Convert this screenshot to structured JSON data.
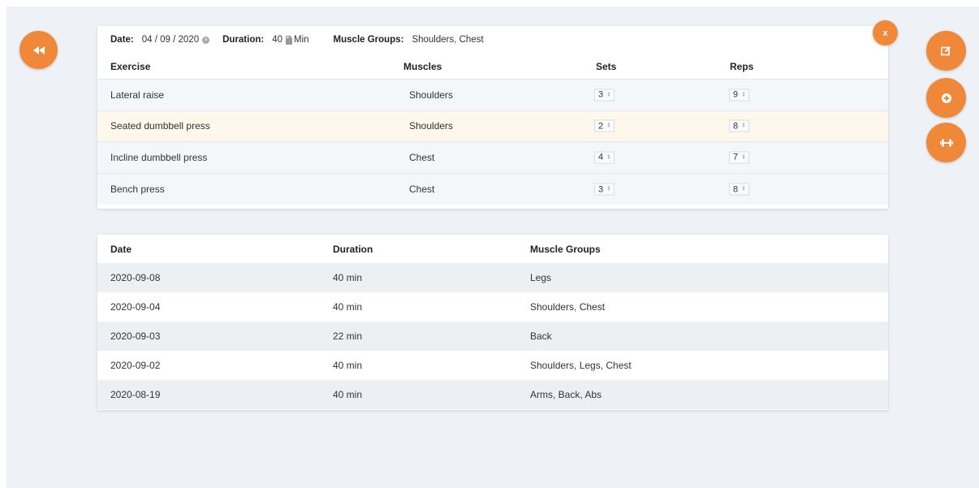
{
  "nav": {
    "back_icon": "rewind-icon",
    "close_label": "x",
    "side_buttons": [
      {
        "icon": "edit-icon",
        "glyph": "✎"
      },
      {
        "icon": "plus-circle-icon",
        "glyph": "⊕"
      },
      {
        "icon": "dumbbell-icon",
        "glyph": "⦁┃⦁"
      }
    ]
  },
  "workout": {
    "date_label": "Date:",
    "date_value": "04 / 09 / 2020",
    "duration_label": "Duration:",
    "duration_value": "40",
    "duration_unit": "Min",
    "muscle_groups_label": "Muscle Groups:",
    "muscle_groups_value": "Shoulders, Chest",
    "columns": {
      "exercise": "Exercise",
      "muscles": "Muscles",
      "sets": "Sets",
      "reps": "Reps"
    },
    "exercises": [
      {
        "name": "Lateral raise",
        "muscles": "Shoulders",
        "sets": "3",
        "reps": "9"
      },
      {
        "name": "Seated dumbbell press",
        "muscles": "Shoulders",
        "sets": "2",
        "reps": "8"
      },
      {
        "name": "Incline dumbbell press",
        "muscles": "Chest",
        "sets": "4",
        "reps": "7"
      },
      {
        "name": "Bench press",
        "muscles": "Chest",
        "sets": "3",
        "reps": "8"
      }
    ]
  },
  "history": {
    "columns": {
      "date": "Date",
      "duration": "Duration",
      "muscle_groups": "Muscle Groups"
    },
    "rows": [
      {
        "date": "2020-09-08",
        "duration": "40 min",
        "muscle_groups": "Legs"
      },
      {
        "date": "2020-09-04",
        "duration": "40 min",
        "muscle_groups": "Shoulders, Chest"
      },
      {
        "date": "2020-09-03",
        "duration": "22 min",
        "muscle_groups": "Back"
      },
      {
        "date": "2020-09-02",
        "duration": "40 min",
        "muscle_groups": "Shoulders, Legs, Chest"
      },
      {
        "date": "2020-08-19",
        "duration": "40 min",
        "muscle_groups": "Arms, Back, Abs"
      }
    ]
  },
  "colors": {
    "accent": "#f0883a",
    "background": "#eef1f5",
    "selected_row": "#fdf8eb"
  }
}
